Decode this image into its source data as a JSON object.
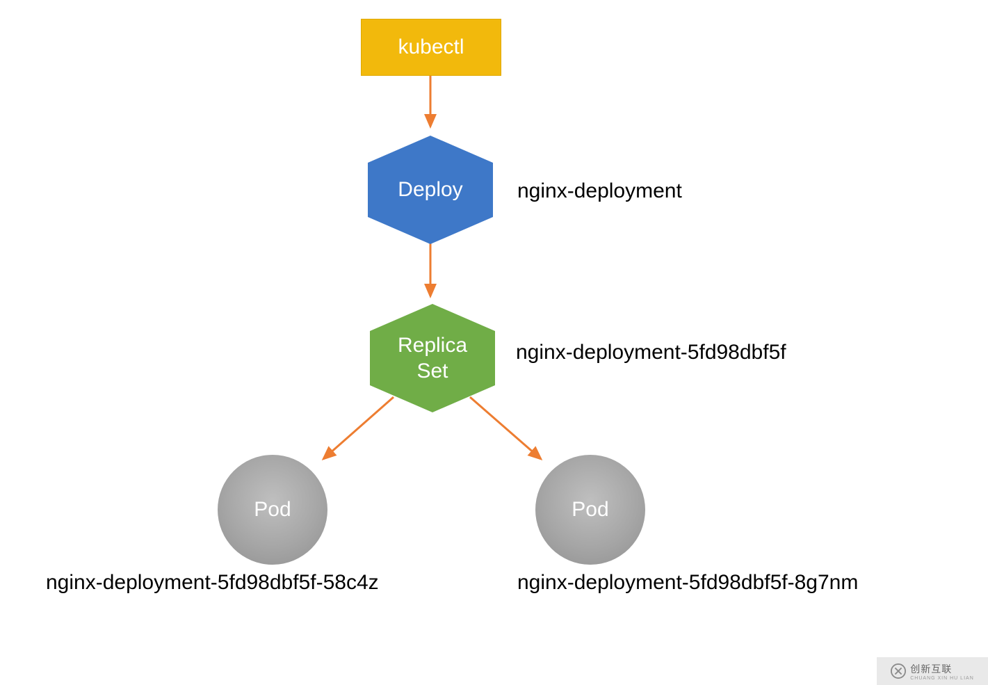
{
  "nodes": {
    "kubectl": {
      "label": "kubectl"
    },
    "deploy": {
      "label": "Deploy",
      "side_label": "nginx-deployment"
    },
    "replicaset": {
      "label1": "Replica",
      "label2": "Set",
      "side_label": "nginx-deployment-5fd98dbf5f"
    },
    "pod_left": {
      "label": "Pod",
      "caption": "nginx-deployment-5fd98dbf5f-58c4z"
    },
    "pod_right": {
      "label": "Pod",
      "caption": "nginx-deployment-5fd98dbf5f-8g7nm"
    }
  },
  "colors": {
    "kubectl_bg": "#F2B90C",
    "deploy_bg": "#3E78C8",
    "rs_bg": "#70AD47",
    "pod_bg": "#A6A6A6",
    "arrow": "#ED7D31"
  },
  "watermark": {
    "text": "创新互联",
    "sub": "CHUANG XIN HU LIAN"
  }
}
